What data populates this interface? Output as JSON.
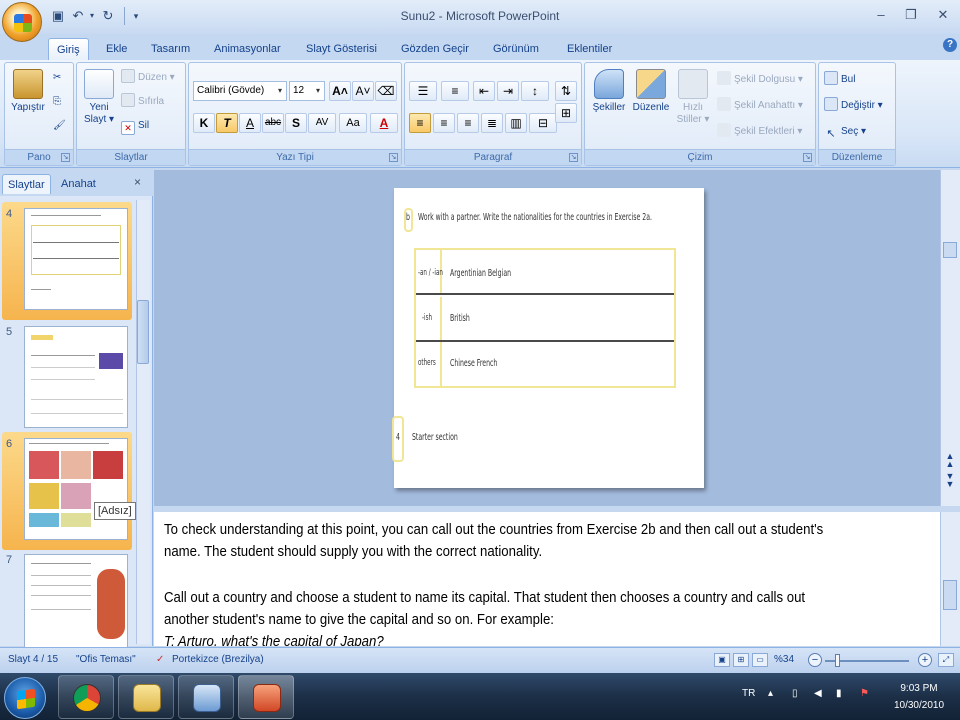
{
  "window": {
    "title": "Sunu2 - Microsoft PowerPoint"
  },
  "qat": {
    "save_icon": "floppy-disk-icon",
    "undo_icon": "undo-icon",
    "redo_icon": "redo-icon",
    "customize_icon": "customize-qat-icon"
  },
  "tabs": [
    "Giriş",
    "Ekle",
    "Tasarım",
    "Animasyonlar",
    "Slayt Gösterisi",
    "Gözden Geçir",
    "Görünüm",
    "Eklentiler"
  ],
  "ribbon": {
    "pano": {
      "label": "Pano",
      "paste": "Yapıştır"
    },
    "slaytlar": {
      "label": "Slaytlar",
      "new_slide": "Yeni",
      "new_slide2": "Slayt ▾",
      "layout": "Düzen ▾",
      "reset": "Sıfırla",
      "delete": "Sil"
    },
    "yazi_tipi": {
      "label": "Yazı Tipi",
      "font": "Calibri (Gövde)",
      "size": "12",
      "bold": "K",
      "italic": "T",
      "underline": "A",
      "strike": "abc",
      "shadow": "S",
      "spacing": "AV",
      "case": "Aa",
      "color": "A"
    },
    "paragraf": {
      "label": "Paragraf"
    },
    "cizim": {
      "label": "Çizim",
      "shapes": "Şekiller",
      "arrange": "Düzenle",
      "styles": "Hızlı",
      "styles2": "Stiller ▾",
      "fill": "Şekil Dolgusu ▾",
      "outline": "Şekil Anahattı ▾",
      "effects": "Şekil Efektleri ▾"
    },
    "duzenleme": {
      "label": "Düzenleme",
      "find": "Bul",
      "replace": "Değiştir ▾",
      "select": "Seç ▾"
    }
  },
  "pane": {
    "tabs": [
      "Slaytlar",
      "Anahat"
    ],
    "close": "×",
    "thumb_numbers": [
      "4",
      "5",
      "6",
      "7"
    ],
    "tooltip": "[Adsız]"
  },
  "slide": {
    "number": "b",
    "instruction": "Work with a partner. Write the nationalities for the countries in Exercise 2a.",
    "rows": [
      {
        "suffix": "-an / -ian",
        "entries": "Argentinian   Belgian"
      },
      {
        "suffix": "-ish",
        "entries": "British"
      },
      {
        "suffix": "others",
        "entries": "Chinese   French"
      }
    ],
    "side_number": "4",
    "footer_text": "Starter section"
  },
  "notes": {
    "line1": "To check understanding at this point, you can call out the countries from Exercise 2b and then call out a student's",
    "line2": "name. The student should supply you with the correct nationality.",
    "line3": "Call out a country and choose a student to name its capital. That student then chooses a country and calls out",
    "line4": "another student's name  to give the capital and so on. For example:",
    "line5": "T: Arturo, what's the capital of Japan?"
  },
  "status": {
    "slide": "Slayt 4 / 15",
    "theme": "\"Ofis Teması\"",
    "language": "Portekizce (Brezilya)",
    "zoom": "%34"
  },
  "taskbar": {
    "language": "TR",
    "time": "9:03 PM",
    "date": "10/30/2010"
  },
  "colors": {
    "ribbon": "#dbe7f6",
    "selected_thumb": "#f6b44d",
    "slide_table_border": "#f1e596",
    "editor_bg": "#a3bbdd"
  }
}
